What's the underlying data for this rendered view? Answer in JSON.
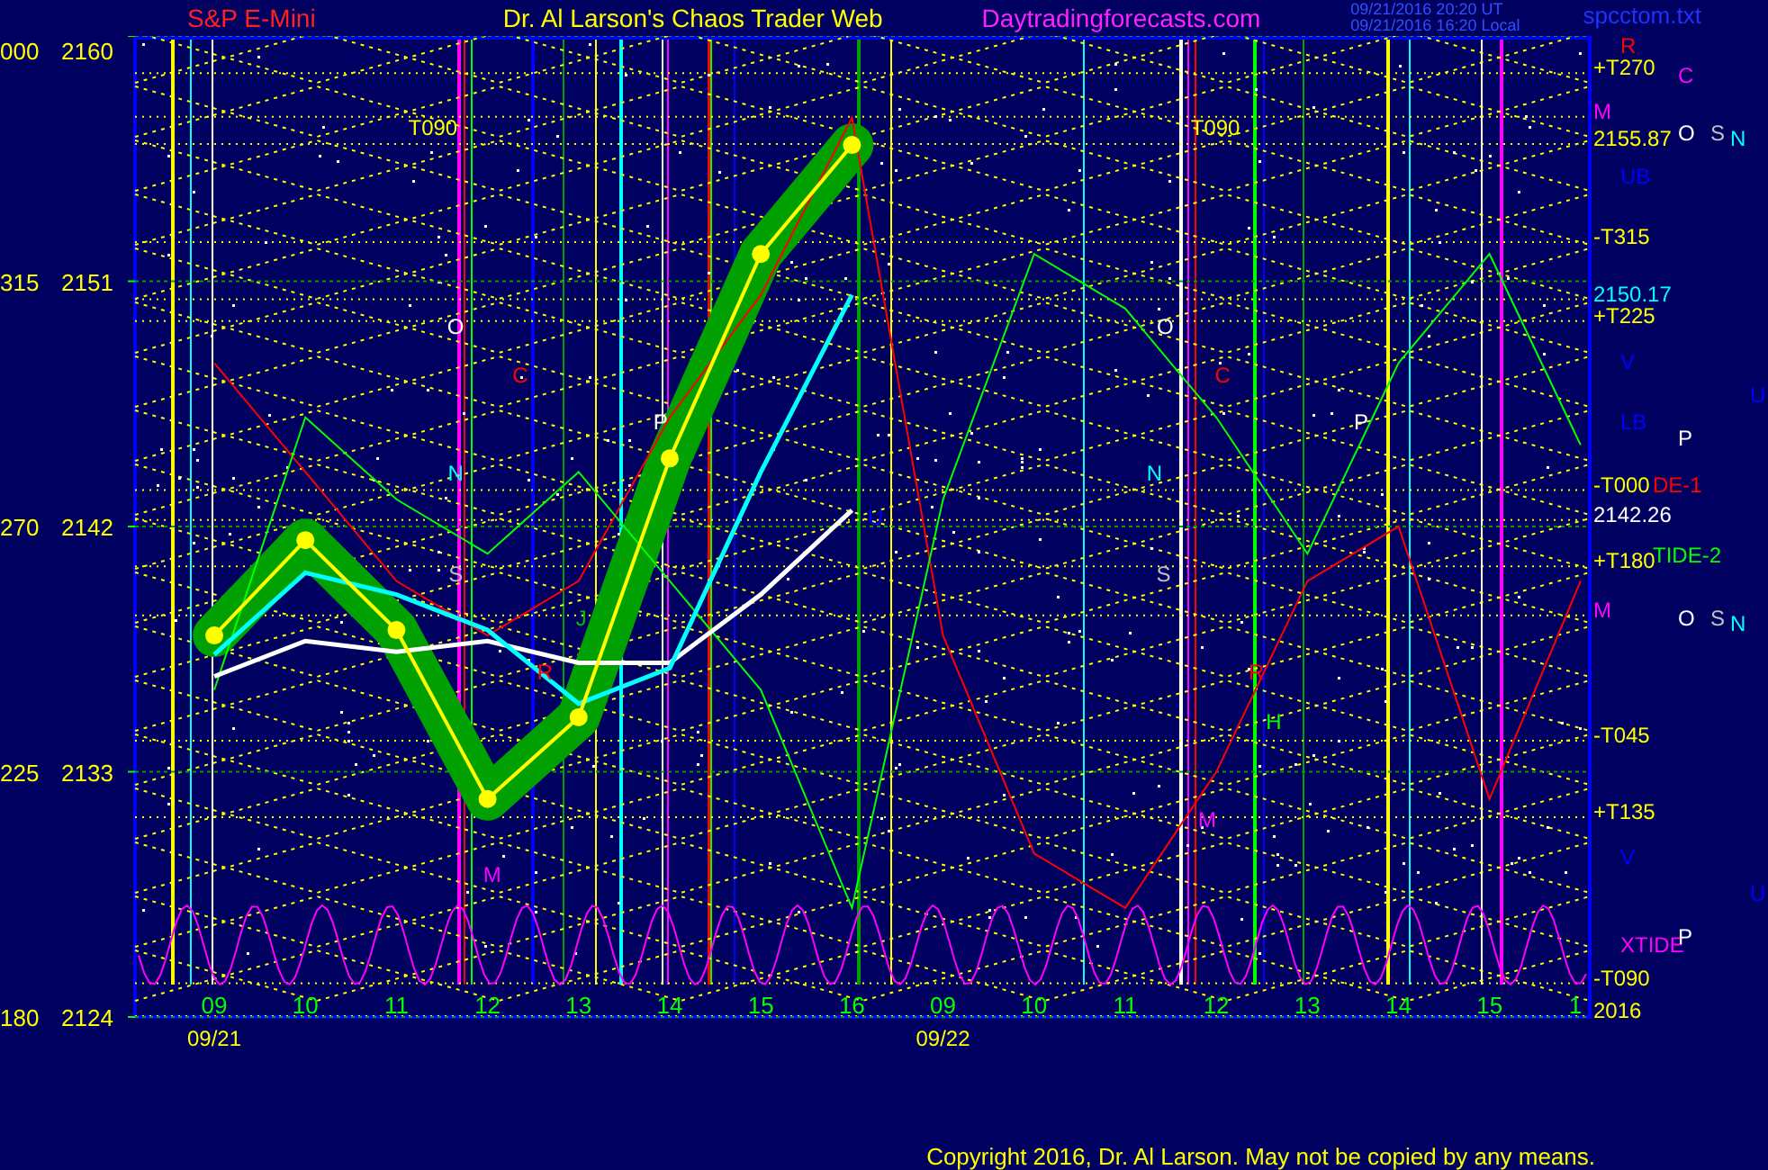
{
  "header": {
    "instrument": "S&P E-Mini",
    "title": "Dr. Al Larson's Chaos Trader Web",
    "website": "Daytradingforecasts.com",
    "timestamps": [
      "09/21/2016 20:20 UT",
      "09/21/2016 16:20 Local"
    ],
    "file_name": "spcctom.txt"
  },
  "chart": {
    "chart_data": {
      "type": "line",
      "ylim": [
        2124,
        2160
      ],
      "grid": true,
      "yticks": [
        2160,
        2151,
        2142,
        2133,
        2124
      ],
      "categories": [
        "09",
        "10",
        "11",
        "12",
        "13",
        "14",
        "15",
        "16",
        "09",
        "10",
        "11",
        "12",
        "13",
        "14",
        "15",
        "1"
      ],
      "series": [
        {
          "color": "#ffff00",
          "marker": "circle",
          "values": [
            2138,
            2141.5,
            2138.2,
            2132,
            2135,
            2144.5,
            2152,
            2156,
            null,
            null,
            null,
            null,
            null,
            null,
            null,
            null
          ]
        },
        {
          "color": "#00ffff",
          "values": [
            2137.3,
            2140.3,
            2139.5,
            2138.2,
            2135.5,
            2136.8,
            2144,
            2150.5,
            null,
            null,
            null,
            null,
            null,
            null,
            null,
            null
          ]
        },
        {
          "color": "#ffffff",
          "values": [
            2136.5,
            2137.8,
            2137.4,
            2137.8,
            2137,
            2137,
            2139.5,
            2142.6,
            null,
            null,
            null,
            null,
            null,
            null,
            null,
            null
          ]
        },
        {
          "color": "#00ff00",
          "values": [
            2136,
            2146,
            2143,
            2141,
            2144,
            2140,
            2136,
            2128,
            2143,
            2152,
            2150,
            2146,
            2141,
            2148,
            2152,
            2145
          ]
        },
        {
          "color": "#ff0000",
          "values": [
            2148,
            2144,
            2140,
            2138,
            2140,
            2146,
            2150.5,
            2157,
            2138,
            2130,
            2128,
            2133,
            2140,
            2142,
            2132,
            2140
          ]
        }
      ]
    },
    "angle_labels": [
      "000",
      "315",
      "270",
      "225",
      "180"
    ],
    "date_labels": [
      "09/21",
      "09/22"
    ],
    "markers": [
      {
        "text": "T090",
        "color": "#ffff00"
      },
      {
        "text": "T090",
        "color": "#ffff00"
      },
      {
        "text": "O",
        "color": "#ffffff"
      },
      {
        "text": "O",
        "color": "#ffffff"
      },
      {
        "text": "C",
        "color": "#ff0000"
      },
      {
        "text": "C",
        "color": "#ff0000"
      },
      {
        "text": "N",
        "color": "#00ffff"
      },
      {
        "text": "N",
        "color": "#00ffff"
      },
      {
        "text": "P",
        "color": "#ffffff"
      },
      {
        "text": "P",
        "color": "#ffffff"
      },
      {
        "text": "U",
        "color": "#0000ff"
      },
      {
        "text": "S",
        "color": "#c0c0c0"
      },
      {
        "text": "S",
        "color": "#c0c0c0"
      },
      {
        "text": "J",
        "color": "#00c000"
      },
      {
        "text": "R",
        "color": "#ff0000"
      },
      {
        "text": "R",
        "color": "#ff0000"
      },
      {
        "text": "H",
        "color": "#00ff00"
      },
      {
        "text": "M",
        "color": "#ff00ff"
      },
      {
        "text": "M",
        "color": "#ff00ff"
      }
    ],
    "right_labels": [
      {
        "text": "R",
        "color": "#ff0000"
      },
      {
        "text": "+T270",
        "color": "#ffff00"
      },
      {
        "text": "C",
        "color": "#ff00ff"
      },
      {
        "text": "M",
        "color": "#ff00ff"
      },
      {
        "text": "2155.87",
        "color": "#ffff00"
      },
      {
        "text": "O",
        "color": "#ffffff"
      },
      {
        "text": "S",
        "color": "#c0c0c0"
      },
      {
        "text": "N",
        "color": "#00ffff"
      },
      {
        "text": "UB",
        "color": "#0000ff"
      },
      {
        "text": "-T315",
        "color": "#ffff00"
      },
      {
        "text": "2150.17",
        "color": "#00ffff"
      },
      {
        "text": "+T225",
        "color": "#ffff00"
      },
      {
        "text": "V",
        "color": "#0000ff"
      },
      {
        "text": "U",
        "color": "#0000ff"
      },
      {
        "text": "LB",
        "color": "#0000ff"
      },
      {
        "text": "P",
        "color": "#ffffff"
      },
      {
        "text": "-T000",
        "color": "#ffff00"
      },
      {
        "text": "DE-1",
        "color": "#ff0000"
      },
      {
        "text": "2142.26",
        "color": "#ffffff"
      },
      {
        "text": "+T180",
        "color": "#ffff00"
      },
      {
        "text": "TIDE-2",
        "color": "#00ff00"
      },
      {
        "text": "M",
        "color": "#ff00ff"
      },
      {
        "text": "O",
        "color": "#ffffff"
      },
      {
        "text": "S",
        "color": "#c0c0c0"
      },
      {
        "text": "N",
        "color": "#00ffff"
      },
      {
        "text": "-T045",
        "color": "#ffff00"
      },
      {
        "text": "+T135",
        "color": "#ffff00"
      },
      {
        "text": "V",
        "color": "#0000ff"
      },
      {
        "text": "U",
        "color": "#0000ff"
      },
      {
        "text": "XTIDE",
        "color": "#ff00ff"
      },
      {
        "text": "P",
        "color": "#ffffff"
      },
      {
        "text": "-T090",
        "color": "#ffff00"
      },
      {
        "text": "2016",
        "color": "#ffff00"
      }
    ]
  },
  "copyright": "Copyright 2016, Dr. Al Larson. May not be copied by any means."
}
